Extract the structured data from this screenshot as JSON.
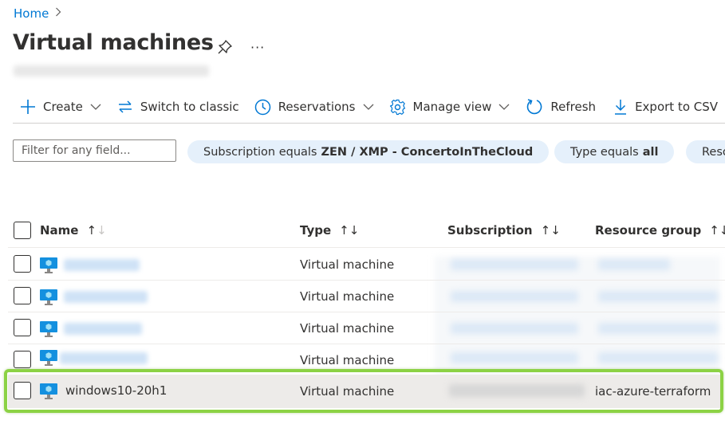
{
  "breadcrumb": {
    "home": "Home",
    "separator": "›"
  },
  "page": {
    "title": "Virtual machines",
    "more_label": "···",
    "subtitle_redacted": true
  },
  "toolbar": {
    "create": "Create",
    "switch_classic": "Switch to classic",
    "reservations": "Reservations",
    "manage_view": "Manage view",
    "refresh": "Refresh",
    "export_csv": "Export to CSV"
  },
  "filters": {
    "search_placeholder": "Filter for any field...",
    "search_value": "",
    "pills": [
      {
        "prefix": "Subscription equals",
        "value": "ZEN / XMP - ConcertoInTheCloud"
      },
      {
        "prefix": "Type equals",
        "value": "all"
      },
      {
        "prefix": "Reso",
        "value": ""
      }
    ]
  },
  "table": {
    "columns": [
      {
        "label": "Name",
        "sort": "↑↓"
      },
      {
        "label": "Type",
        "sort": "↑↓"
      },
      {
        "label": "Subscription",
        "sort": "↑↓"
      },
      {
        "label": "Resource group",
        "sort": "↑↓"
      }
    ],
    "rows": [
      {
        "name": "",
        "name_redacted": true,
        "type": "Virtual machine",
        "subscription_redacted": true,
        "resource_group_redacted": true
      },
      {
        "name": "",
        "name_redacted": true,
        "type": "Virtual machine",
        "subscription_redacted": true,
        "resource_group_redacted": true
      },
      {
        "name": "",
        "name_redacted": true,
        "type": "Virtual machine",
        "subscription_redacted": true,
        "resource_group_redacted": true
      },
      {
        "name": "",
        "name_redacted": true,
        "type": "Virtual machine",
        "subscription_redacted": true,
        "resource_group_redacted": true
      },
      {
        "name": "windows10-20h1",
        "name_redacted": false,
        "type": "Virtual machine",
        "subscription_redacted": true,
        "resource_group": "iac-azure-terraform",
        "highlighted": true
      }
    ]
  },
  "colors": {
    "accent": "#0078d4",
    "pill_bg": "#e5f0fb",
    "highlight": "#8cd245",
    "selected_row": "#edebe9"
  }
}
